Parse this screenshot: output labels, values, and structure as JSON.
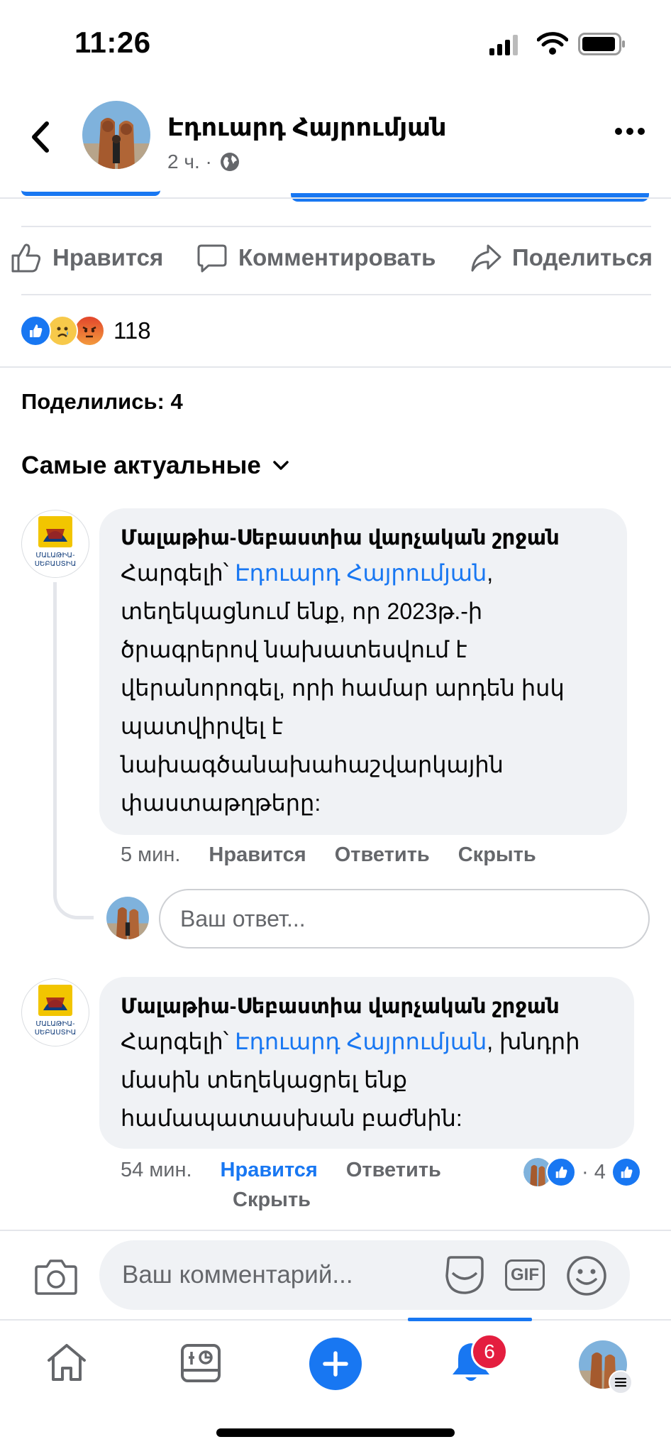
{
  "status_bar": {
    "time": "11:26"
  },
  "header": {
    "name": "Էդուարդ Հայրումյան",
    "meta": "2 ч. ·"
  },
  "actions": {
    "like": "Нравится",
    "comment": "Комментировать",
    "share": "Поделиться"
  },
  "reactions": {
    "count": "118",
    "types": [
      "like",
      "sad",
      "angry"
    ]
  },
  "shares_text": "Поделились: 4",
  "sort_label": "Самые актуальные",
  "comments": [
    {
      "author": "Մալաթիա-Սեբաստիա վարչական շրջան",
      "lines": [
        [
          "Հարգելի՝ ",
          "Էդուարդ Հայրումյան",
          ","
        ],
        "տեղեկացնում ենք, որ 2023թ.-ի",
        "ծրագրերով նախատեսվում է",
        "վերանորոգել, որի համար արդեն իսկ",
        "պատվիրվել է",
        "նախագծանախահաշվարկային",
        "փաստաթղթերը:"
      ],
      "time": "5 мин.",
      "like": "Нравится",
      "reply": "Ответить",
      "hide": "Скрыть"
    },
    {
      "author": "Մալաթիա-Սեբաստիա վարչական շրջան",
      "lines": [
        [
          "Հարգելի՝ ",
          "Էդուարդ Հայրումյան",
          ", խնդրի"
        ],
        "մասին տեղեկացրել ենք",
        "համապատասխան բաժնին:"
      ],
      "time": "54 мин.",
      "like": "Нравится",
      "reply": "Ответить",
      "hide": "Скрыть",
      "reaction_count": "· 4"
    }
  ],
  "page_logo_text": [
    "ՄԱԼԱԹԻԱ-",
    "ՍԵԲԱՍՏԻԱ"
  ],
  "reply_placeholder": "Ваш ответ...",
  "composer_placeholder": "Ваш комментарий...",
  "gif_label": "GIF",
  "nav": {
    "notifications_badge": "6"
  },
  "colors": {
    "accent": "#1877f2",
    "text_secondary": "#65676b",
    "bubble": "#f0f2f5",
    "badge": "#e41e3f"
  }
}
